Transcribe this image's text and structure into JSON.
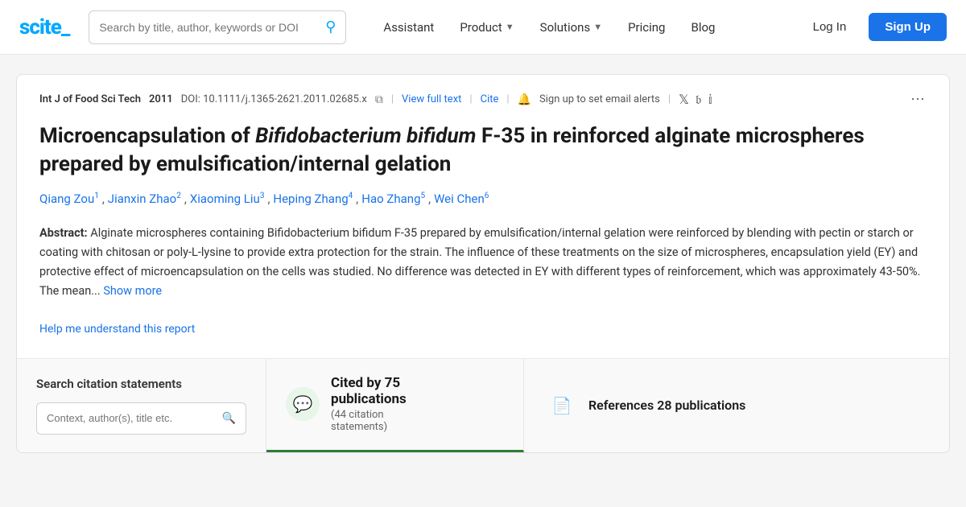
{
  "navbar": {
    "logo_text": "scite_",
    "logo_underscore": "_",
    "search_placeholder": "Search by title, author, keywords or DOI",
    "links": [
      {
        "id": "assistant",
        "label": "Assistant",
        "has_dropdown": false
      },
      {
        "id": "product",
        "label": "Product",
        "has_dropdown": true
      },
      {
        "id": "solutions",
        "label": "Solutions",
        "has_dropdown": true
      },
      {
        "id": "pricing",
        "label": "Pricing",
        "has_dropdown": false
      },
      {
        "id": "blog",
        "label": "Blog",
        "has_dropdown": false
      }
    ],
    "login_label": "Log In",
    "signup_label": "Sign Up"
  },
  "article": {
    "journal": "Int J of Food Sci Tech",
    "year": "2011",
    "doi": "DOI: 10.1111/j.1365-2621.2011.02685.x",
    "view_full_text": "View full text",
    "cite": "Cite",
    "alert_text": "Sign up to set email alerts",
    "title": "Microencapsulation of Bifidobacterium bifidum F-35 in reinforced alginate microspheres prepared by emulsification/internal gelation",
    "authors": [
      {
        "name": "Qiang Zou",
        "sup": "1"
      },
      {
        "name": "Jianxin Zhao",
        "sup": "2"
      },
      {
        "name": "Xiaoming Liu",
        "sup": "3"
      },
      {
        "name": "Heping Zhang",
        "sup": "4"
      },
      {
        "name": "Hao Zhang",
        "sup": "5"
      },
      {
        "name": "Wei Chen",
        "sup": "6"
      }
    ],
    "abstract_label": "Abstract:",
    "abstract_text": "Alginate microspheres containing Bifidobacterium bifidum F-35 prepared by emulsification/internal gelation were reinforced by blending with pectin or starch or coating with chitosan or poly-L-lysine to provide extra protection for the strain. The influence of these treatments on the size of microspheres, encapsulation yield (EY) and protective effect of microencapsulation on the cells was studied. No difference was detected in EY with different types of reinforcement, which was approximately 43-50%. The mean...",
    "show_more": "Show more",
    "help_link": "Help me understand this report"
  },
  "bottom": {
    "search_label": "Search citation statements",
    "search_placeholder": "Context, author(s), title etc.",
    "cited_by_label": "Cited by 75 publications",
    "cited_by_main": "Cited by 75",
    "cited_by_sub_main": "publications",
    "citation_statements": "(44 citation statements)",
    "citation_statements_line1": "(44 citation",
    "citation_statements_line2": "statements)",
    "references_label": "References 28 publications"
  }
}
